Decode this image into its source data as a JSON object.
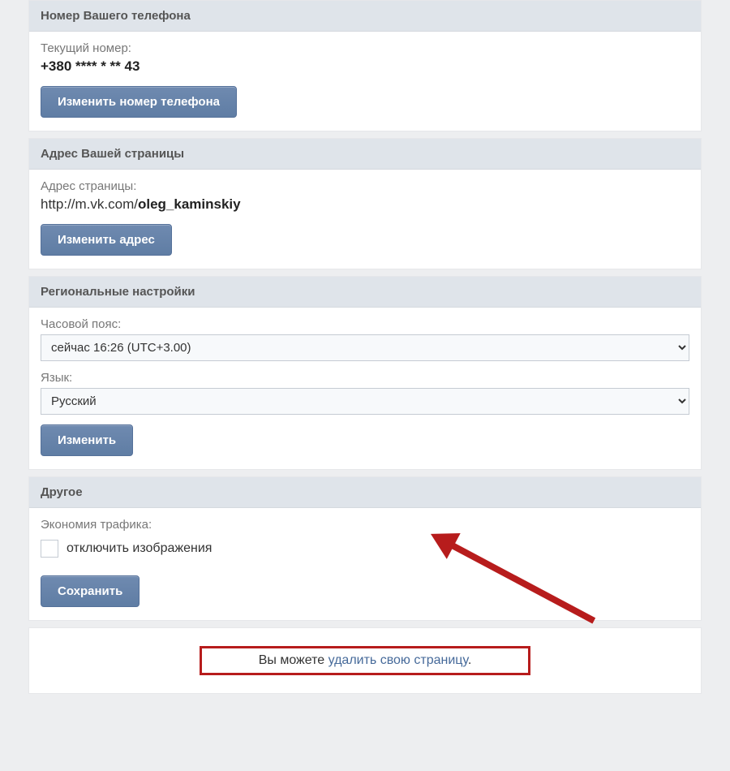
{
  "sections": {
    "phone": {
      "header": "Номер Вашего телефона",
      "current_label": "Текущий номер:",
      "current_value": "+380 **** * ** 43",
      "button": "Изменить номер телефона"
    },
    "address": {
      "header": "Адрес Вашей страницы",
      "label": "Адрес страницы:",
      "url_prefix": "http://m.vk.com/",
      "url_slug": "oleg_kaminskiy",
      "button": "Изменить адрес"
    },
    "regional": {
      "header": "Региональные настройки",
      "tz_label": "Часовой пояс:",
      "tz_value": "сейчас 16:26 (UTC+3.00)",
      "lang_label": "Язык:",
      "lang_value": "Русский",
      "button": "Изменить"
    },
    "other": {
      "header": "Другое",
      "traffic_label": "Экономия трафика:",
      "checkbox_label": "отключить изображения",
      "button": "Сохранить"
    },
    "footer": {
      "prefix": "Вы можете ",
      "link": "удалить свою страницу",
      "suffix": "."
    }
  }
}
